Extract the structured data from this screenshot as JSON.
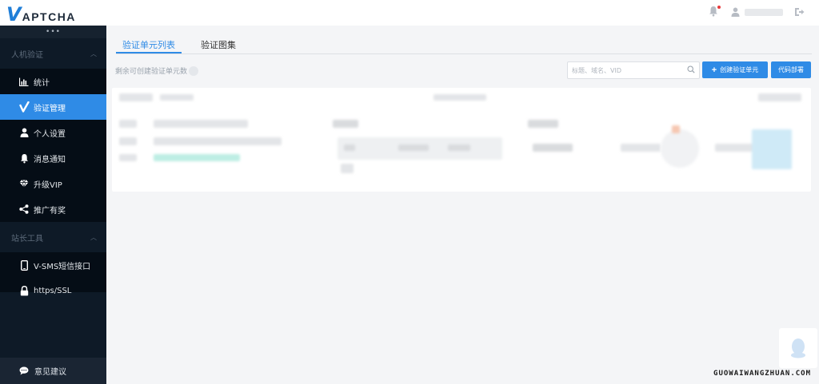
{
  "header": {
    "logo_initial": "V",
    "logo_rest": "APTCHA"
  },
  "sidebar": {
    "groups": [
      {
        "label": "人机验证",
        "items": [
          {
            "label": "统计",
            "icon": "bar-chart-icon"
          },
          {
            "label": "验证管理",
            "icon": "check-icon",
            "active": true
          },
          {
            "label": "个人设置",
            "icon": "user-icon"
          },
          {
            "label": "消息通知",
            "icon": "bell-icon"
          },
          {
            "label": "升级VIP",
            "icon": "diamond-icon"
          },
          {
            "label": "推广有奖",
            "icon": "share-icon"
          }
        ]
      },
      {
        "label": "站长工具",
        "items": [
          {
            "label": "V-SMS短信接口",
            "icon": "phone-icon"
          },
          {
            "label": "https/SSL",
            "icon": "lock-icon"
          }
        ]
      }
    ],
    "feedback_label": "意见建议",
    "dots": "•••"
  },
  "main": {
    "tabs": [
      {
        "label": "验证单元列表",
        "active": true
      },
      {
        "label": "验证图集",
        "active": false
      }
    ],
    "remaining_label": "剩余可创建验证单元数",
    "search_placeholder": "标题、域名、VID",
    "create_button": "创建验证单元",
    "create_button_icon": "plus-icon",
    "code_button": "代码部署"
  },
  "colors": {
    "accent": "#2f8be6",
    "sidebar_bg": "#050d16",
    "notification_dot": "#e8393b"
  },
  "watermark": "GUOWAIWANGZHUAN.COM"
}
